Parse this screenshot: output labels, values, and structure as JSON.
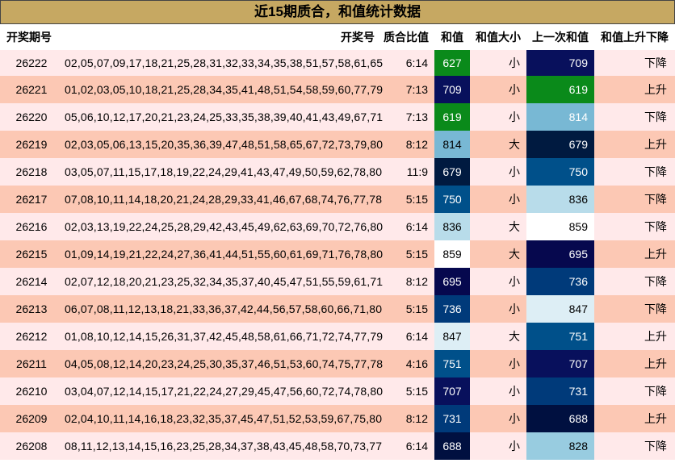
{
  "title": "近15期质合，和值统计数据",
  "headers": {
    "issue": "开奖期号",
    "numbers": "开奖号",
    "ratio": "质合比值",
    "sum": "和值",
    "size": "和值大小",
    "prev": "上一次和值",
    "trend": "和值上升下降"
  },
  "rows": [
    {
      "issue": "26222",
      "numbers": "02,05,07,09,17,18,21,25,28,31,32,33,34,35,38,51,57,58,61,65",
      "ratio": "6:14",
      "sum": "627",
      "sum_bg": "#0a8a1a",
      "sum_fg": "#ffffff",
      "size": "小",
      "prev": "709",
      "prev_bg": "#08105c",
      "prev_fg": "#ffffff",
      "trend": "下降"
    },
    {
      "issue": "26221",
      "numbers": "01,02,03,05,10,18,21,25,28,34,35,41,48,51,54,58,59,60,77,79",
      "ratio": "7:13",
      "sum": "709",
      "sum_bg": "#08105c",
      "sum_fg": "#ffffff",
      "size": "小",
      "prev": "619",
      "prev_bg": "#0a8a1a",
      "prev_fg": "#ffffff",
      "trend": "上升"
    },
    {
      "issue": "26220",
      "numbers": "05,06,10,12,17,20,21,23,24,25,33,35,38,39,40,41,43,49,67,71",
      "ratio": "7:13",
      "sum": "619",
      "sum_bg": "#0a8a1a",
      "sum_fg": "#ffffff",
      "size": "小",
      "prev": "814",
      "prev_bg": "#78b8d4",
      "prev_fg": "#ffffff",
      "trend": "下降"
    },
    {
      "issue": "26219",
      "numbers": "02,03,05,06,13,15,20,35,36,39,47,48,51,58,65,67,72,73,79,80",
      "ratio": "8:12",
      "sum": "814",
      "sum_bg": "#78b8d4",
      "sum_fg": "#000000",
      "size": "大",
      "prev": "679",
      "prev_bg": "#001a40",
      "prev_fg": "#ffffff",
      "trend": "上升"
    },
    {
      "issue": "26218",
      "numbers": "03,05,07,11,15,17,18,19,22,24,29,41,43,47,49,50,59,62,78,80",
      "ratio": "11:9",
      "sum": "679",
      "sum_bg": "#001a40",
      "sum_fg": "#ffffff",
      "size": "小",
      "prev": "750",
      "prev_bg": "#00508a",
      "prev_fg": "#ffffff",
      "trend": "下降"
    },
    {
      "issue": "26217",
      "numbers": "07,08,10,11,14,18,20,21,24,28,29,33,41,46,67,68,74,76,77,78",
      "ratio": "5:15",
      "sum": "750",
      "sum_bg": "#00508a",
      "sum_fg": "#ffffff",
      "size": "小",
      "prev": "836",
      "prev_bg": "#b8dcea",
      "prev_fg": "#000000",
      "trend": "下降"
    },
    {
      "issue": "26216",
      "numbers": "02,03,13,19,22,24,25,28,29,42,43,45,49,62,63,69,70,72,76,80",
      "ratio": "6:14",
      "sum": "836",
      "sum_bg": "#b8dcea",
      "sum_fg": "#000000",
      "size": "大",
      "prev": "859",
      "prev_bg": "#ffffff",
      "prev_fg": "#000000",
      "trend": "下降"
    },
    {
      "issue": "26215",
      "numbers": "01,09,14,19,21,22,24,27,36,41,44,51,55,60,61,69,71,76,78,80",
      "ratio": "5:15",
      "sum": "859",
      "sum_bg": "#ffffff",
      "sum_fg": "#000000",
      "size": "大",
      "prev": "695",
      "prev_bg": "#06084e",
      "prev_fg": "#ffffff",
      "trend": "上升"
    },
    {
      "issue": "26214",
      "numbers": "02,07,12,18,20,21,23,25,32,34,35,37,40,45,47,51,55,59,61,71",
      "ratio": "8:12",
      "sum": "695",
      "sum_bg": "#06084e",
      "sum_fg": "#ffffff",
      "size": "小",
      "prev": "736",
      "prev_bg": "#003a7a",
      "prev_fg": "#ffffff",
      "trend": "下降"
    },
    {
      "issue": "26213",
      "numbers": "06,07,08,11,12,13,18,21,33,36,37,42,44,56,57,58,60,66,71,80",
      "ratio": "5:15",
      "sum": "736",
      "sum_bg": "#003a7a",
      "sum_fg": "#ffffff",
      "size": "小",
      "prev": "847",
      "prev_bg": "#ddeef5",
      "prev_fg": "#000000",
      "trend": "下降"
    },
    {
      "issue": "26212",
      "numbers": "01,08,10,12,14,15,26,31,37,42,45,48,58,61,66,71,72,74,77,79",
      "ratio": "6:14",
      "sum": "847",
      "sum_bg": "#ddeef5",
      "sum_fg": "#000000",
      "size": "大",
      "prev": "751",
      "prev_bg": "#00508a",
      "prev_fg": "#ffffff",
      "trend": "上升"
    },
    {
      "issue": "26211",
      "numbers": "04,05,08,12,14,20,23,24,25,30,35,37,46,51,53,60,74,75,77,78",
      "ratio": "4:16",
      "sum": "751",
      "sum_bg": "#00508a",
      "sum_fg": "#ffffff",
      "size": "小",
      "prev": "707",
      "prev_bg": "#08105c",
      "prev_fg": "#ffffff",
      "trend": "上升"
    },
    {
      "issue": "26210",
      "numbers": "03,04,07,12,14,15,17,21,22,24,27,29,45,47,56,60,72,74,78,80",
      "ratio": "5:15",
      "sum": "707",
      "sum_bg": "#08105c",
      "sum_fg": "#ffffff",
      "size": "小",
      "prev": "731",
      "prev_bg": "#003a7a",
      "prev_fg": "#ffffff",
      "trend": "下降"
    },
    {
      "issue": "26209",
      "numbers": "02,04,10,11,14,16,18,23,32,35,37,45,47,51,52,53,59,67,75,80",
      "ratio": "8:12",
      "sum": "731",
      "sum_bg": "#003a7a",
      "sum_fg": "#ffffff",
      "size": "小",
      "prev": "688",
      "prev_bg": "#001040",
      "prev_fg": "#ffffff",
      "trend": "上升"
    },
    {
      "issue": "26208",
      "numbers": "08,11,12,13,14,15,16,23,25,28,34,37,38,43,45,48,58,70,73,77",
      "ratio": "6:14",
      "sum": "688",
      "sum_bg": "#001040",
      "sum_fg": "#ffffff",
      "size": "小",
      "prev": "828",
      "prev_bg": "#98cce0",
      "prev_fg": "#000000",
      "trend": "下降"
    }
  ]
}
